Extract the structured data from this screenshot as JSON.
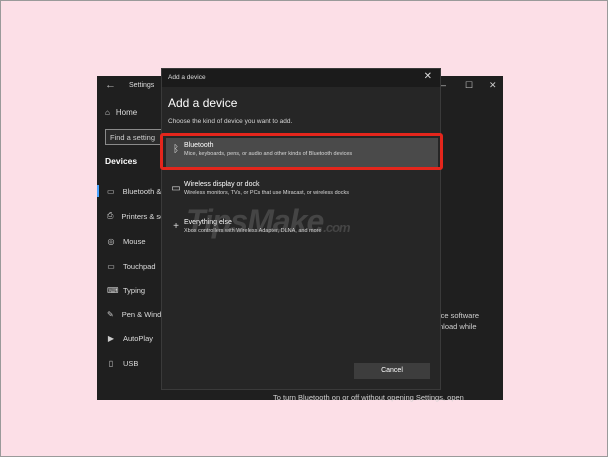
{
  "settings": {
    "title": "Settings",
    "home": "Home",
    "find_placeholder": "Find a setting",
    "section": "Devices",
    "nav": [
      {
        "label": "Bluetooth & other devices",
        "icon": "bluetooth-icon",
        "glyph": "▭"
      },
      {
        "label": "Printers & scanners",
        "icon": "printer-icon",
        "glyph": "⎙"
      },
      {
        "label": "Mouse",
        "icon": "mouse-icon",
        "glyph": "◎"
      },
      {
        "label": "Touchpad",
        "icon": "touchpad-icon",
        "glyph": "▭"
      },
      {
        "label": "Typing",
        "icon": "keyboard-icon",
        "glyph": "⌨"
      },
      {
        "label": "Pen & Windows Ink",
        "icon": "pen-icon",
        "glyph": "✎"
      },
      {
        "label": "AutoPlay",
        "icon": "autoplay-icon",
        "glyph": "▶"
      },
      {
        "label": "USB",
        "icon": "usb-icon",
        "glyph": "▯"
      }
    ],
    "right_text_1": "ice software",
    "right_text_2": "nload while",
    "bottom_text": "To turn Bluetooth on or off without opening Settings, open"
  },
  "dialog": {
    "titlebar": "Add a device",
    "heading": "Add a device",
    "subtitle": "Choose the kind of device you want to add.",
    "options": [
      {
        "name": "Bluetooth",
        "desc": "Mice, keyboards, pens, or audio and other kinds of Bluetooth devices"
      },
      {
        "name": "Wireless display or dock",
        "desc": "Wireless monitors, TVs, or PCs that use Miracast, or wireless docks"
      },
      {
        "name": "Everything else",
        "desc": "Xbox controllers with Wireless Adapter, DLNA, and more"
      }
    ],
    "cancel_label": "Cancel"
  },
  "watermark": {
    "main": "TipsMake",
    "suffix": ".com"
  },
  "colors": {
    "highlight": "#e4261c",
    "accent": "#4aa3ff"
  }
}
